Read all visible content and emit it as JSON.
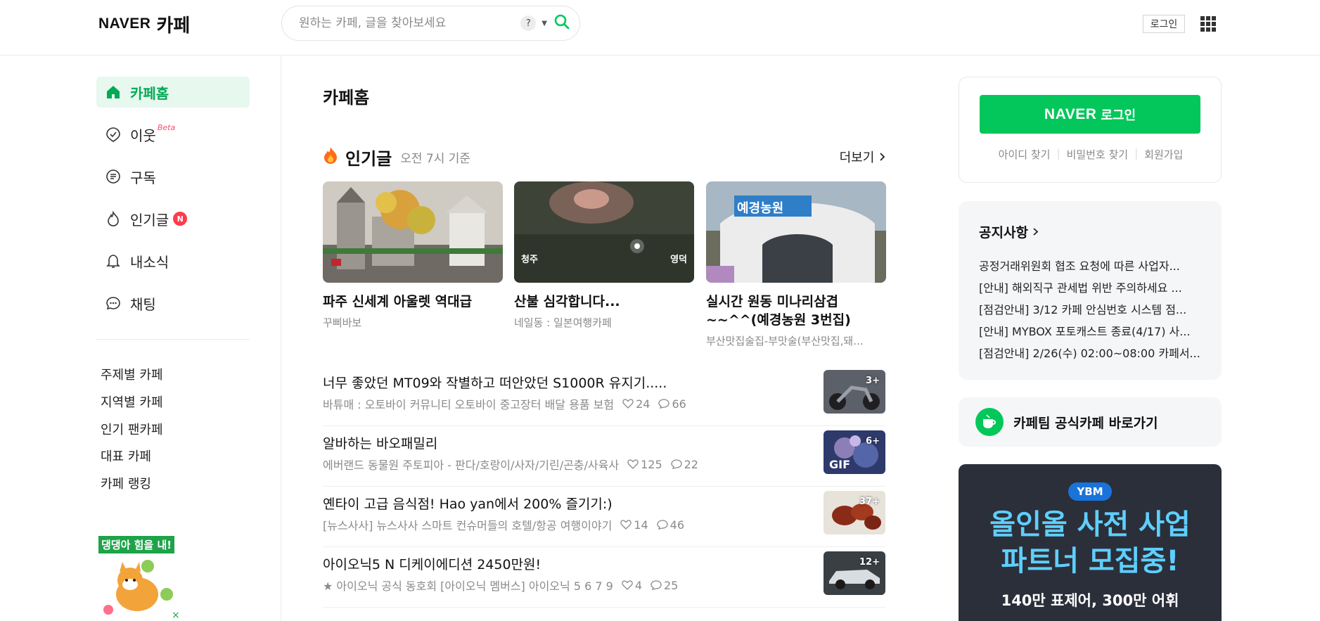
{
  "header": {
    "logo_naver": "NAVER",
    "logo_cafe": "카페",
    "search_placeholder": "원하는 카페, 글을 찾아보세요",
    "help": "?",
    "login": "로그인"
  },
  "sidebar": {
    "items": [
      {
        "label": "카페홈",
        "icon": "home-icon"
      },
      {
        "label": "이웃",
        "icon": "check-badge-icon",
        "badge": "Beta"
      },
      {
        "label": "구독",
        "icon": "subscribe-icon"
      },
      {
        "label": "인기글",
        "icon": "flame-icon",
        "badge": "N"
      },
      {
        "label": "내소식",
        "icon": "bell-icon"
      },
      {
        "label": "채팅",
        "icon": "chat-icon"
      }
    ],
    "links": [
      "주제별 카페",
      "지역별 카페",
      "인기 팬카페",
      "대표 카페",
      "카페 랭킹"
    ],
    "promo_text": "댕댕아 힘을 내!"
  },
  "main": {
    "page_title": "카페홈",
    "popular": {
      "title": "인기글",
      "time": "오전 7시 기준",
      "more": "더보기"
    },
    "cards": [
      {
        "title": "파주 신세계 아울렛 역대급",
        "source": "꾸삐바보"
      },
      {
        "title": "산불 심각합니다...",
        "source": "네일동 : 일본여행카페",
        "overlay_left": "청주",
        "overlay_right": "영덕"
      },
      {
        "title": "실시간 원동 미나리삼겹 ~~^^(예경농원 3번집)",
        "source": "부산맛집술집-부맛술(부산맛집,돼...",
        "overlay_sign": "예경농원"
      }
    ],
    "rows": [
      {
        "title": "너무 좋았던 MT09와 작별하고 떠안았던 S1000R 유지기.....",
        "meta": "바튜매 : 오토바이 커뮤니티 오토바이 중고장터 배달 용품 보험",
        "likes": "24",
        "comments": "66",
        "count": "3+"
      },
      {
        "title": "알바하는 바오패밀리",
        "meta": "에버랜드 동물원 주토피아 - 판다/호랑이/사자/기린/곤충/사육사",
        "likes": "125",
        "comments": "22",
        "count": "6+",
        "gif": "GIF"
      },
      {
        "title": "옌타이 고급 음식점! Hao yan에서 200% 즐기기:)",
        "meta": "[뉴스사사] 뉴스사사 스마트 컨슈머들의 호텔/항공 여행이야기",
        "likes": "14",
        "comments": "46",
        "count": "37+"
      },
      {
        "title": "아이오닉5 N 디케이에디션 2450만원!",
        "meta": "★ 아이오닉 공식 동호회 [아이오닉 멤버스] 아이오닉 5 6 7 9",
        "likes": "4",
        "comments": "25",
        "count": "12+"
      }
    ]
  },
  "right": {
    "login_naver": "NAVER",
    "login_text": "로그인",
    "links": [
      "아이디 찾기",
      "비밀번호 찾기",
      "회원가입"
    ],
    "notice_title": "공지사항",
    "notices": [
      "공정거래위원회 협조 요청에 따른 사업자...",
      "[안내] 해외직구 관세법 위반 주의하세요 ...",
      "[점검안내] 3/12 카페 안심번호 시스템 점...",
      "[안내] MYBOX 포토캐스트 종료(4/17) 사...",
      "[점검안내] 2/26(수) 02:00~08:00 카페서..."
    ],
    "cafeteam": "카페팀 공식카페 바로가기",
    "ad": {
      "brand": "YBM",
      "line1": "올인올 사전 사업",
      "line2": "파트너 모집중!",
      "line3": "140만 표제어, 300만 어휘"
    }
  },
  "colors": {
    "brand_green": "#03c75a",
    "active_bg": "#e7f8ee",
    "badge_red": "#ff3b4a"
  }
}
